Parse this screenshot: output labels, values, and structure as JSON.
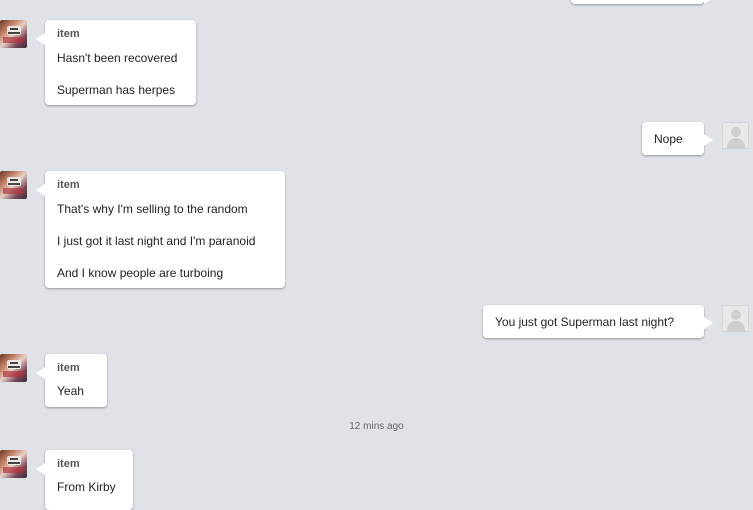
{
  "conversation": {
    "messages": [
      {
        "sender": "item",
        "lines": [
          "Hasn't been recovered",
          "Superman has herpes"
        ]
      },
      {
        "me": "Nope"
      },
      {
        "sender": "item",
        "lines": [
          "That's why I'm selling to the random",
          "I just got it last night and I'm paranoid",
          "And I know people are turboing"
        ]
      },
      {
        "me": "You just got Superman last night?"
      },
      {
        "sender": "item",
        "lines": [
          "Yeah"
        ]
      },
      {
        "timestamp": "12 mins ago"
      },
      {
        "sender": "item",
        "lines": [
          "From Kirby"
        ]
      }
    ]
  }
}
